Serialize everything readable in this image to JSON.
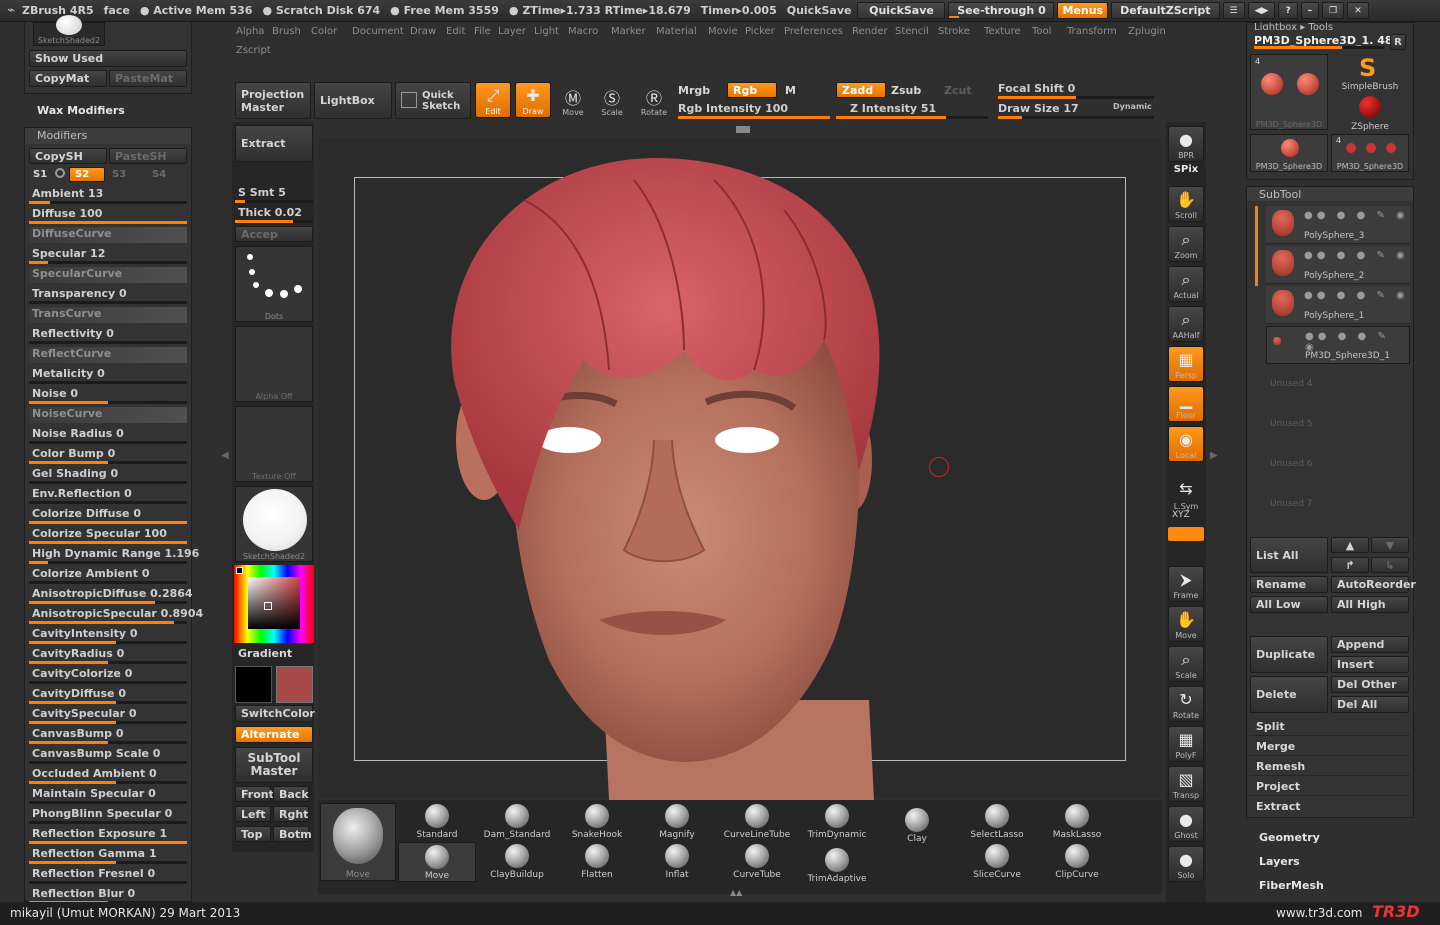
{
  "topbar": {
    "app": "ZBrush 4R5",
    "doc": "face",
    "active_mem": "● Active Mem 536",
    "scratch": "● Scratch Disk 674",
    "free_mem": "● Free Mem 3559",
    "ztime": "● ZTime▸1.733 RTime▸18.679",
    "timer": "Timer▸0.005",
    "quicksave_label": "QuickSave",
    "quicksave_btn": "QuickSave",
    "seethrough": "See-through  0",
    "menus": "Menus",
    "script": "DefaultZScript",
    "win_btns": [
      "☰",
      "◀▶",
      "?",
      "–",
      "❐",
      "✕"
    ]
  },
  "menu": [
    "Alpha",
    "Brush",
    "Color",
    "Document",
    "Draw",
    "Edit",
    "File",
    "Layer",
    "Light",
    "Macro",
    "Marker",
    "Material",
    "Movie",
    "Picker",
    "Preferences",
    "Render",
    "Stencil",
    "Stroke",
    "Texture",
    "Tool",
    "Transform",
    "Zplugin",
    "Zscript"
  ],
  "left_top": {
    "thumb_label": "SketchShaded2",
    "show_used": "Show  Used",
    "copymat": "CopyMat",
    "pastemat": "PasteMat",
    "wax": "Wax  Modifiers",
    "modifiers": "Modifiers",
    "copysh": "CopySH",
    "pastesh": "PasteSH",
    "s1": "S1",
    "s2": "S2",
    "s3": "S3",
    "s4": "S4"
  },
  "modifiers": [
    {
      "label": "Ambient",
      "value": "13",
      "fill": 0.13
    },
    {
      "label": "Diffuse",
      "value": "100",
      "fill": 1.0
    },
    {
      "label": "DiffuseCurve",
      "curve": true
    },
    {
      "label": "Specular",
      "value": "12",
      "fill": 0.12
    },
    {
      "label": "SpecularCurve",
      "curve": true
    },
    {
      "label": "Transparency",
      "value": "0",
      "fill": 0
    },
    {
      "label": "TransCurve",
      "curve": true
    },
    {
      "label": "Reflectivity",
      "value": "0",
      "fill": 0
    },
    {
      "label": "ReflectCurve",
      "curve": true
    },
    {
      "label": "Metalicity",
      "value": "0",
      "fill": 0
    },
    {
      "label": "Noise",
      "value": "0",
      "fill": 0.5
    },
    {
      "label": "NoiseCurve",
      "curve": true
    },
    {
      "label": "Noise  Radius",
      "value": "0",
      "fill": 0
    },
    {
      "label": "Color  Bump",
      "value": "0",
      "fill": 0.5
    },
    {
      "label": "Gel  Shading",
      "value": "0",
      "fill": 0
    },
    {
      "label": "Env.Reflection",
      "value": "0",
      "fill": 0
    },
    {
      "label": "Colorize  Diffuse",
      "value": "0",
      "fill": 1.0
    },
    {
      "label": "Colorize  Specular",
      "value": "100",
      "fill": 1.0
    },
    {
      "label": "High  Dynamic  Range",
      "value": "1.196",
      "fill": 0.12
    },
    {
      "label": "Colorize  Ambient",
      "value": "0",
      "fill": 0
    },
    {
      "label": "AnisotropicDiffuse",
      "value": "0.2864",
      "fill": 0.8
    },
    {
      "label": "AnisotropicSpecular",
      "value": "0.8904",
      "fill": 0.92
    },
    {
      "label": "CavityIntensity",
      "value": "0",
      "fill": 0.55
    },
    {
      "label": "CavityRadius",
      "value": "0",
      "fill": 0.5
    },
    {
      "label": "CavityColorize",
      "value": "0",
      "fill": 0
    },
    {
      "label": "CavityDiffuse",
      "value": "0",
      "fill": 0.55
    },
    {
      "label": "CavitySpecular",
      "value": "0",
      "fill": 0.55
    },
    {
      "label": "CanvasBump",
      "value": "0",
      "fill": 0.5
    },
    {
      "label": "CanvasBump  Scale",
      "value": "0",
      "fill": 0
    },
    {
      "label": "Occluded    Ambient",
      "value": "0",
      "fill": 0.55
    },
    {
      "label": "Maintain  Specular",
      "value": "0",
      "fill": 0
    },
    {
      "label": "PhongBlinn  Specular",
      "value": "0",
      "fill": 0
    },
    {
      "label": "Reflection  Exposure",
      "value": "1",
      "fill": 1.0
    },
    {
      "label": "Reflection  Gamma",
      "value": "1",
      "fill": 0.55
    },
    {
      "label": "Reflection  Fresnel",
      "value": "0",
      "fill": 0
    },
    {
      "label": "Reflection  Blur",
      "value": "0",
      "fill": 0.5
    }
  ],
  "toolbar": {
    "projection_master": "Projection\nMaster",
    "lightbox": "LightBox",
    "quick_sketch": "Quick\nSketch",
    "edit": "Edit",
    "draw": "Draw",
    "move": "Move",
    "scale": "Scale",
    "rotate": "Rotate",
    "mrgb": "Mrgb",
    "rgb": "Rgb",
    "m": "M",
    "zadd": "Zadd",
    "zsub": "Zsub",
    "zcut": "Zcut",
    "rgb_intensity": "Rgb  Intensity 100",
    "z_intensity": "Z  Intensity 51",
    "focal_shift": "Focal  Shift 0",
    "draw_size": "Draw  Size 17",
    "dynamic": "Dynamic"
  },
  "left_col": {
    "extract": "Extract",
    "s_smt": "S  Smt 5",
    "thick": "Thick 0.02",
    "accep": "Accep",
    "dots": "Dots",
    "alpha_off": "Alpha  Off",
    "texture_off": "Texture  Off",
    "material": "SketchShaded2",
    "gradient": "Gradient",
    "switchcolor": "SwitchColor",
    "alternate": "Alternate",
    "subtool_master": "SubTool\nMaster",
    "front": "Front",
    "back": "Back",
    "left": "Left",
    "right": "Rght",
    "top": "Top",
    "bottom": "Botm",
    "main_color": "#000000",
    "secondary_color": "#a84848"
  },
  "right_tools": [
    {
      "glyph": "●",
      "cap": "BPR"
    },
    {
      "glyph": "SPix",
      "cap": ""
    },
    {
      "glyph": "✋",
      "cap": "Scroll"
    },
    {
      "glyph": "⌕",
      "cap": "Zoom"
    },
    {
      "glyph": "⌕",
      "cap": "Actual"
    },
    {
      "glyph": "⌕",
      "cap": "AAHalf"
    },
    {
      "glyph": "▦",
      "cap": "Persp"
    },
    {
      "glyph": "▁",
      "cap": "Floor"
    },
    {
      "glyph": "◉",
      "cap": "Local"
    },
    {
      "glyph": "⇆",
      "cap": "L.Sym"
    },
    {
      "glyph": "⮞",
      "cap": "Frame"
    },
    {
      "glyph": "✋",
      "cap": "Move"
    },
    {
      "glyph": "⌕",
      "cap": "Scale"
    },
    {
      "glyph": "↻",
      "cap": "Rotate"
    },
    {
      "glyph": "▦",
      "cap": "PolyF"
    },
    {
      "glyph": "▧",
      "cap": "Transp"
    },
    {
      "glyph": "●",
      "cap": "Ghost"
    },
    {
      "glyph": "●",
      "cap": "Solo"
    }
  ],
  "xyz_label": "XYZ",
  "brushes": {
    "current": "Move",
    "row1": [
      "Standard",
      "Dam_Standard",
      "SnakeHook",
      "Magnify",
      "CurveLineTube",
      "TrimDynamic",
      "Clay",
      "SelectLasso",
      "MaskLasso"
    ],
    "row2": [
      "Move",
      "ClayBuildup",
      "Flatten",
      "Inflat",
      "CurveTube",
      "TrimAdaptive",
      "SliceCurve",
      "ClipCurve"
    ]
  },
  "tool_panel": {
    "header": "Lightbox ▸ Tools",
    "current": "PM3D_Sphere3D_1. 48",
    "r": "R",
    "thumbs": [
      "PM3D_Sphere3D",
      "SimpleBrush",
      "ZSphere",
      "PM3D_Sphere3D",
      "PM3D_Sphere3D"
    ],
    "count": "4",
    "count2": "4"
  },
  "subtool": {
    "title": "SubTool",
    "items": [
      "PolySphere_3",
      "PolySphere_2",
      "PolySphere_1",
      "PM3D_Sphere3D_1"
    ],
    "unused": [
      "Unused  4",
      "Unused  5",
      "Unused  6",
      "Unused  7"
    ],
    "list_all": "List  All",
    "rename": "Rename",
    "autoreorder": "AutoReorder",
    "all_low": "All  Low",
    "all_high": "All  High",
    "duplicate": "Duplicate",
    "append": "Append",
    "insert": "Insert",
    "delete": "Delete",
    "del_other": "Del  Other",
    "del_all": "Del  All",
    "split": "Split",
    "merge": "Merge",
    "remesh": "Remesh",
    "project": "Project",
    "extract": "Extract",
    "geometry": "Geometry",
    "layers": "Layers",
    "fibermesh": "FiberMesh"
  },
  "footer": {
    "credit": "mikayil (Umut MORKAN)  29 Mart 2013",
    "site": "www.tr3d.com",
    "logo": "TR3D"
  }
}
